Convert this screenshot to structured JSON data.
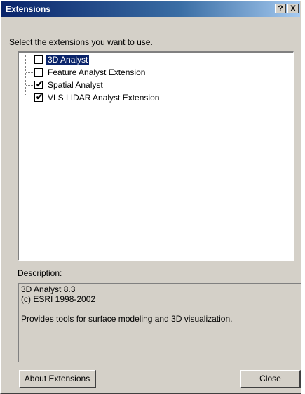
{
  "window": {
    "title": "Extensions",
    "help_label": "?",
    "close_label": "X"
  },
  "prompt": "Select the extensions you want to use.",
  "extensions": [
    {
      "label": "3D Analyst",
      "checked": false,
      "selected": true
    },
    {
      "label": "Feature Analyst Extension",
      "checked": false,
      "selected": false
    },
    {
      "label": "Spatial Analyst",
      "checked": true,
      "selected": false
    },
    {
      "label": "VLS LIDAR Analyst Extension",
      "checked": true,
      "selected": false
    }
  ],
  "check_mark": "✔",
  "description": {
    "label": "Description:",
    "lines": [
      "3D Analyst 8.3",
      "(c) ESRI 1998-2002",
      "",
      "Provides tools for surface modeling and 3D visualization."
    ]
  },
  "buttons": {
    "about": "About Extensions",
    "close": "Close"
  }
}
